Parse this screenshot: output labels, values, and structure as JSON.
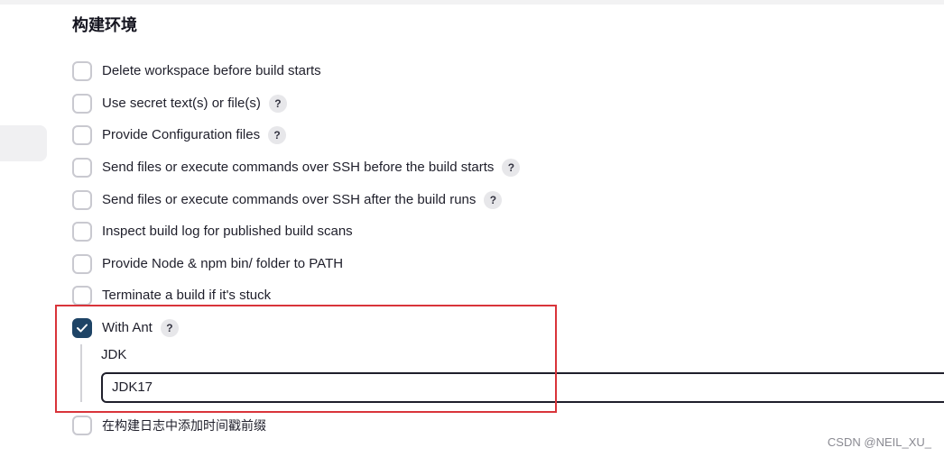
{
  "section": {
    "title": "构建环境"
  },
  "options": [
    {
      "label": "Delete workspace before build starts",
      "checked": false,
      "help": false
    },
    {
      "label": "Use secret text(s) or file(s)",
      "checked": false,
      "help": true
    },
    {
      "label": "Provide Configuration files",
      "checked": false,
      "help": true
    },
    {
      "label": "Send files or execute commands over SSH before the build starts",
      "checked": false,
      "help": true
    },
    {
      "label": "Send files or execute commands over SSH after the build runs",
      "checked": false,
      "help": true
    },
    {
      "label": "Inspect build log for published build scans",
      "checked": false,
      "help": false
    },
    {
      "label": "Provide Node & npm bin/ folder to PATH",
      "checked": false,
      "help": false
    },
    {
      "label": "Terminate a build if it's stuck",
      "checked": false,
      "help": false
    },
    {
      "label": "With Ant",
      "checked": true,
      "help": true
    },
    {
      "label": "在构建日志中添加时间戳前缀",
      "checked": false,
      "help": false
    }
  ],
  "help_glyph": "?",
  "with_ant": {
    "jdk_label": "JDK",
    "jdk_value": "JDK17"
  },
  "watermark": "CSDN @NEIL_XU_",
  "colors": {
    "checkbox_checked": "#1e4466",
    "highlight": "#d9343a"
  }
}
